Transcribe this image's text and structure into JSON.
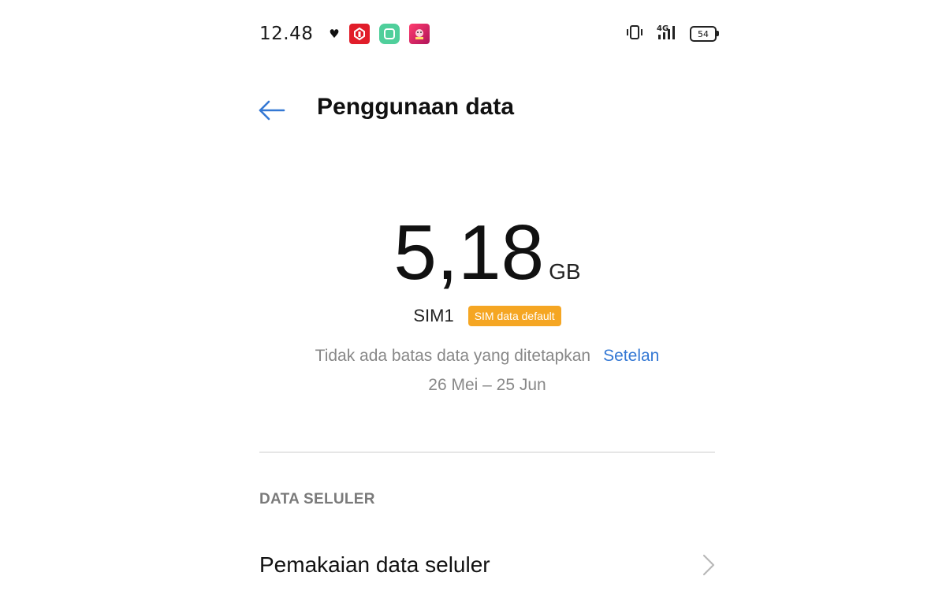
{
  "status_bar": {
    "time": "12.48",
    "notification_icons": [
      "heart-icon",
      "red-app-icon",
      "green-app-icon",
      "game-app-icon"
    ],
    "signal_label": "4G",
    "battery_level": "54"
  },
  "header": {
    "title": "Penggunaan data",
    "back_icon": "arrow-left-icon"
  },
  "usage": {
    "value": "5,18",
    "unit": "GB",
    "sim_label": "SIM1",
    "sim_badge": "SIM data default",
    "limit_text": "Tidak ada batas data yang ditetapkan",
    "settings_link": "Setelan",
    "period": "26 Mei – 25 Jun"
  },
  "section": {
    "header": "DATA SELULER",
    "items": [
      {
        "label": "Pemakaian data seluler",
        "icon": "chevron-right-icon"
      }
    ]
  },
  "colors": {
    "accent": "#3478d4",
    "badge": "#f5a623",
    "muted_text": "#888888",
    "divider": "#e6e6e6"
  }
}
